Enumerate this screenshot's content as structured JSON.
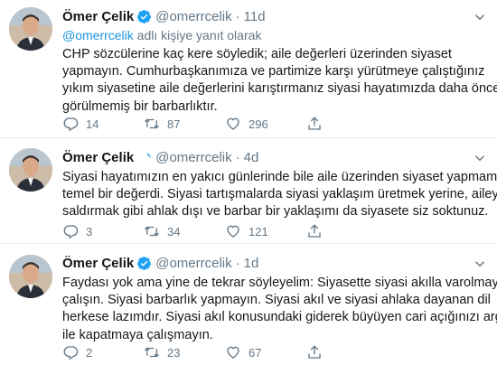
{
  "tweets": [
    {
      "author_name": "Ömer Çelik",
      "handle": "@omerrcelik",
      "separator": "·",
      "time": "11d",
      "reply_mention": "@omerrcelik",
      "reply_suffix": " adlı kişiye yanıt olarak",
      "text_lines": [
        "CHP  sözcülerine kaç kere söyledik; aile değerleri üzerinden siyaset",
        "yapmayın. Cumhurbaşkanımıza ve partimize karşı yürütmeye çalıştığınız",
        "yıkım siyasetine aile değerlerini karıştırmanız siyasi hayatımızda daha önce",
        "görülmemiş bir barbarlıktır."
      ],
      "replies": "14",
      "retweets": "87",
      "likes": "296"
    },
    {
      "author_name": "Ömer Çelik",
      "handle": "@omerrcelik",
      "separator": "·",
      "time": "4d",
      "text_lines": [
        "Siyasi hayatımızın en yakıcı günlerinde bile aile üzerinden siyaset yapmamak",
        "temel bir değerdi. Siyasi tartışmalarda siyasi yaklaşım üretmek yerine, aileye",
        "saldırmak gibi ahlak dışı ve barbar bir yaklaşımı da siyasete siz soktunuz."
      ],
      "replies": "3",
      "retweets": "34",
      "likes": "121"
    },
    {
      "author_name": "Ömer Çelik",
      "handle": "@omerrcelik",
      "separator": "·",
      "time": "1d",
      "text_lines": [
        "Faydası yok ama yine de tekrar söyleyelim: Siyasette siyasi akılla varolmaya",
        "çalışın. Siyasi barbarlık yapmayın. Siyasi akıl ve siyasi ahlaka dayanan dil",
        "herkese lazımdır. Siyasi akıl konusundaki giderek büyüyen cari açığınızı argo",
        "ile kapatmaya çalışmayın."
      ],
      "replies": "2",
      "retweets": "23",
      "likes": "67"
    }
  ],
  "colors": {
    "text": "#14171a",
    "secondary": "#657786",
    "link": "#1b95e0",
    "verified": "#1da1f2",
    "divider": "#e6ecf0"
  },
  "icons": [
    "reply-icon",
    "retweet-icon",
    "like-icon",
    "share-icon",
    "verified-badge-icon",
    "chevron-down-icon"
  ]
}
